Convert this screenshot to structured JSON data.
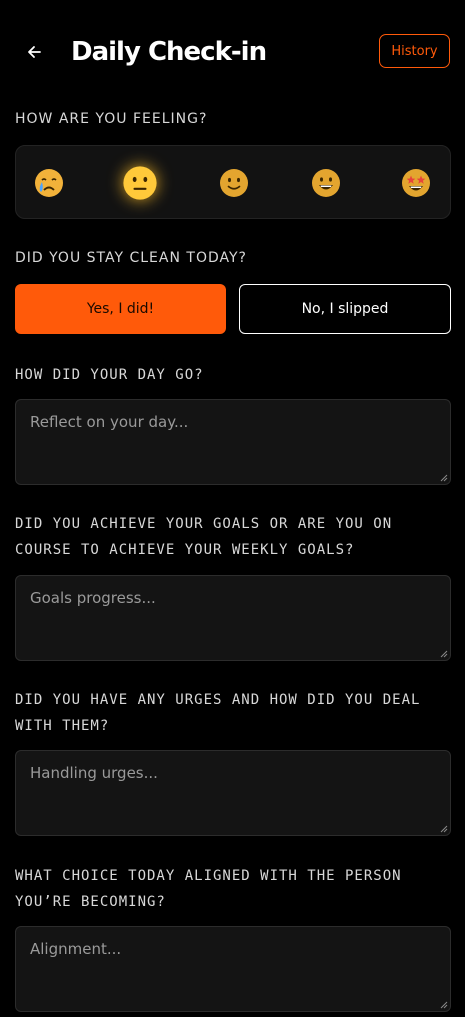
{
  "header": {
    "title": "Daily Check-in",
    "history_label": "History"
  },
  "mood": {
    "question": "HOW ARE YOU FEELING?",
    "options": [
      {
        "name": "sad-crying",
        "selected": false
      },
      {
        "name": "neutral",
        "selected": true
      },
      {
        "name": "slightly-smiling",
        "selected": false
      },
      {
        "name": "grinning",
        "selected": false
      },
      {
        "name": "star-struck",
        "selected": false
      }
    ]
  },
  "clean": {
    "question": "DID YOU STAY CLEAN TODAY?",
    "yes_label": "Yes, I did!",
    "no_label": "No, I slipped",
    "selected": "yes"
  },
  "reflections": [
    {
      "question": "HOW DID YOUR DAY GO?",
      "placeholder": "Reflect on your day...",
      "value": ""
    },
    {
      "question": "DID YOU ACHIEVE YOUR GOALS OR ARE YOU ON COURSE TO ACHIEVE YOUR WEEKLY GOALS?",
      "placeholder": "Goals progress...",
      "value": ""
    },
    {
      "question": "DID YOU HAVE ANY URGES AND HOW DID YOU DEAL WITH THEM?",
      "placeholder": "Handling urges...",
      "value": ""
    },
    {
      "question": "WHAT CHOICE TODAY ALIGNED WITH THE PERSON YOU’RE BECOMING?",
      "placeholder": "Alignment...",
      "value": ""
    }
  ],
  "colors": {
    "accent": "#ff5a0a",
    "background": "#000000",
    "field_background": "#141414"
  }
}
